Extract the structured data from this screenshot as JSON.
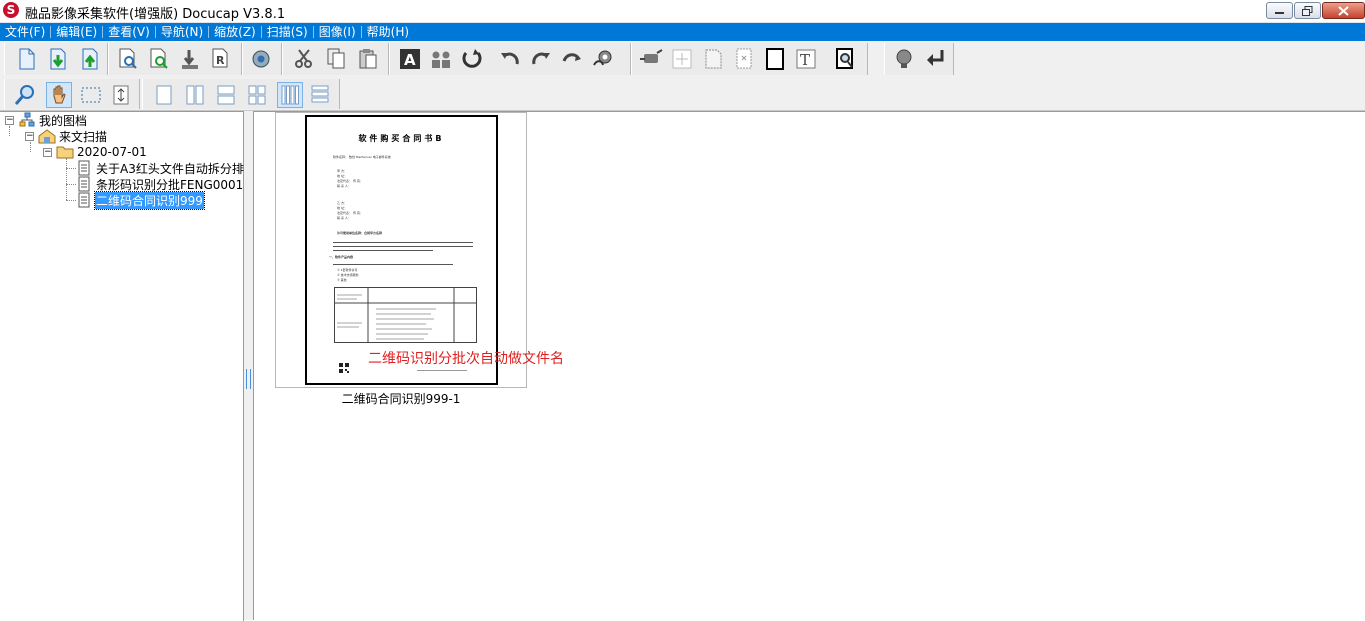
{
  "window": {
    "title": "融品影像采集软件(增强版) Docucap V3.8.1",
    "app_icon_letter": "S"
  },
  "menu": [
    "文件(F)",
    "编辑(E)",
    "查看(V)",
    "导航(N)",
    "缩放(Z)",
    "扫描(S)",
    "图像(I)",
    "帮助(H)"
  ],
  "toolbar1_icons": [
    "new-document-icon",
    "import-down-icon",
    "export-up-icon",
    "find-page-icon",
    "refresh-page-icon",
    "download-page-icon",
    "rename-page-icon",
    "settings-gear-icon",
    "cut-scissors-icon",
    "copy-page-icon",
    "paste-page-icon",
    "text-a-icon",
    "users-icon",
    "rotate-cycle-icon",
    "rotate-left-icon",
    "rotate-right-icon",
    "flip-icon",
    "auto-process-icon",
    "deskew-icon",
    "crop-cross-icon",
    "border-page-icon",
    "blank-page-icon",
    "frame-rect-icon",
    "text-t-icon",
    "ocr-search-icon",
    "lightbulb-icon",
    "return-arrow-icon"
  ],
  "toolbar2_icons": [
    "zoom-magnifier-icon",
    "hand-pan-icon",
    "marquee-select-icon",
    "fit-arrows-icon",
    "single-view-icon",
    "two-column-view-icon",
    "two-row-view-icon",
    "four-grid-view-icon",
    "multi-column-view-icon",
    "list-rows-view-icon"
  ],
  "tree": {
    "root": "我的图档",
    "folder": "来文扫描",
    "date_folder": "2020-07-01",
    "docs": [
      "关于A3红头文件自动拆分排",
      "条形码识别分批FENG0001",
      "二维码合同识别999"
    ],
    "selected_index": 2
  },
  "thumbnail": {
    "caption": "二维码合同识别999-1",
    "overlay_text": "二维码识别分批次自动做文件名",
    "doc_heading": "软件购买合同书B",
    "doc_lines": [
      "软件名称：  数创 MailServer 电子邮件系统",
      "甲    方：",
      "地    址：",
      "法定代表：              传    真：",
      "联 系 人：",
      "乙    方：",
      "地    址：",
      "法定代表：              传    真：",
      "联 系 人：",
      "许可使用单位名称：合同甲方名称",
      "一、软件产品内容",
      "① 1套软件许可",
      "② 技术支持服务",
      "③ 其他"
    ]
  }
}
